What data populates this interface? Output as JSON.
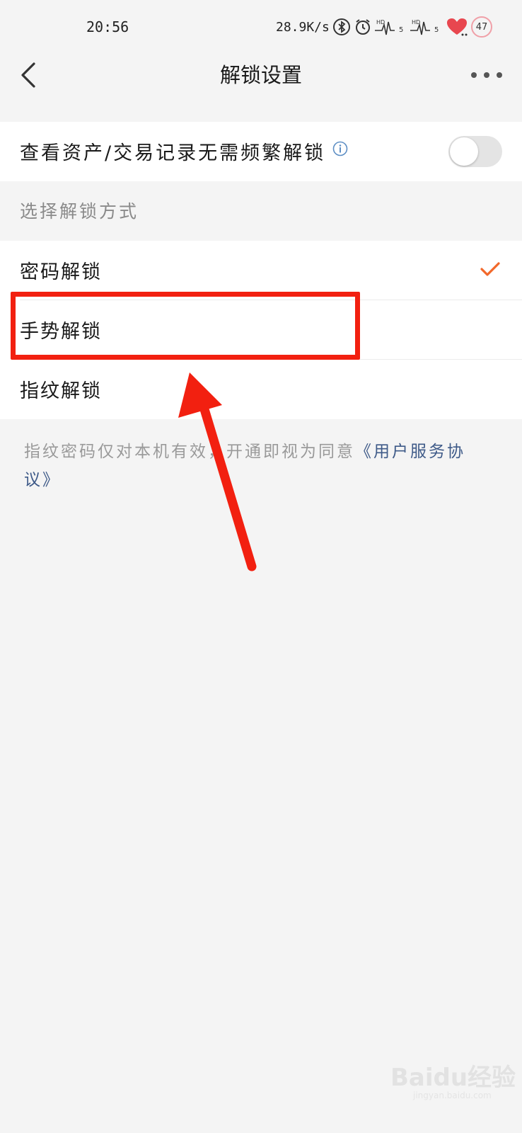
{
  "status_bar": {
    "time": "20:56",
    "network_speed": "28.9K/s",
    "battery": "47",
    "icons": [
      "bluetooth-icon",
      "alarm-icon",
      "signal-hd-5-icon",
      "signal-hd-5-icon",
      "heart-icon",
      "battery-ring-icon"
    ]
  },
  "nav": {
    "title": "解锁设置"
  },
  "quick_view": {
    "label": "查看资产/交易记录无需频繁解锁",
    "toggle_on": false
  },
  "section": {
    "label": "选择解锁方式"
  },
  "unlock_methods": [
    {
      "label": "密码解锁",
      "selected": true
    },
    {
      "label": "手势解锁",
      "selected": false
    },
    {
      "label": "指纹解锁",
      "selected": false
    }
  ],
  "footnote": {
    "text": "指纹密码仅对本机有效，开通即视为同意",
    "link": "《用户服务协议》"
  },
  "watermark": {
    "brand": "Baidu经验",
    "sub": "jingyan.baidu.com"
  },
  "colors": {
    "accent_check": "#f2682a",
    "annotation_red": "#f22010",
    "link_blue": "#3e5a88",
    "info_blue": "#5d8ec4"
  }
}
